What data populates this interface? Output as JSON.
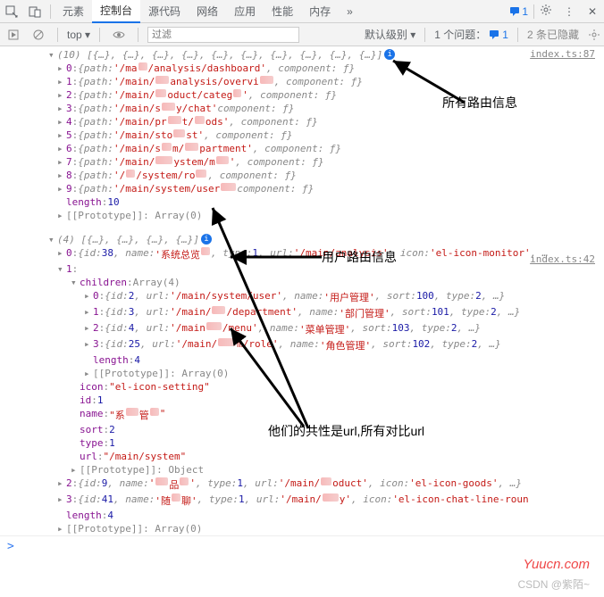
{
  "toolbar": {
    "tabs": [
      "元素",
      "控制台",
      "源代码",
      "网络",
      "应用",
      "性能",
      "内存"
    ],
    "active_tab_index": 1,
    "msg_count": "1",
    "gear_title": "设置",
    "more_glyph": "⋮",
    "close_glyph": "✕"
  },
  "subbar": {
    "context": "top ▾",
    "filter_placeholder": "过滤",
    "level": "默认级别 ▾",
    "issues_label": "1 个问题：",
    "issues_count": "1",
    "hidden_label": "2 条已隐藏"
  },
  "sources": {
    "first": "index.ts:87",
    "second": "index.ts:42"
  },
  "log1": {
    "header_count": "(10)",
    "header_preview": " [{…}, {…}, {…}, {…}, {…}, {…}, {…}, {…}, {…}, {…}]",
    "items": [
      {
        "idx": "0",
        "path_a": "'/ma",
        "path_b": "/analysis/dashboard'",
        "tail": ", component: ƒ}"
      },
      {
        "idx": "1",
        "path_a": "'/main/",
        "path_b": "analysis/overvi",
        "path_c": "",
        "tail": ", component: ƒ}"
      },
      {
        "idx": "2",
        "path_a": "'/main/",
        "path_b": "oduct/categ",
        "path_c": "'",
        "tail": ", component: ƒ}"
      },
      {
        "idx": "3",
        "path_a": "'/main/s",
        "path_b": "y/chat'",
        "tail": "  component: ƒ}"
      },
      {
        "idx": "4",
        "path_a": "'/main/pr",
        "path_b": "t/",
        "path_c": "ods'",
        "tail": ", component: ƒ}"
      },
      {
        "idx": "5",
        "path_a": "'/main/sto",
        "path_b": "st'",
        "tail": ", component: ƒ}"
      },
      {
        "idx": "6",
        "path_a": "'/main/s",
        "path_b": "m/",
        "path_c": "partment'",
        "tail": ", component: ƒ}"
      },
      {
        "idx": "7",
        "path_a": "'/main/",
        "path_b": "ystem/m",
        "path_c": "'",
        "tail": ", component: ƒ}"
      },
      {
        "idx": "8",
        "path_a": "'/",
        "path_b": "/system/ro",
        "path_c": "",
        "tail": ", component: ƒ}"
      },
      {
        "idx": "9",
        "path_a": "'/main/system/user",
        "path_b": "",
        "tail": "component: ƒ}"
      }
    ],
    "length_label": "length",
    "length_value": "10",
    "proto_label": "[[Prototype]]: Array(0)"
  },
  "log2": {
    "header_count": "(4)",
    "header_preview": " [{…}, {…}, {…}, {…}]",
    "item0": {
      "idx": "0",
      "id": "38",
      "name": "'系统总览",
      "type": "1",
      "url": "'/main/analysis'",
      "icon": "'el-icon-monitor'"
    },
    "item1_idx": "1",
    "children_label": "children",
    "children_type": "Array(4)",
    "children": [
      {
        "idx": "0",
        "id": "2",
        "url": "'/main/system/user'",
        "name": "'用户管理'",
        "sort": "100",
        "type": "2"
      },
      {
        "idx": "1",
        "id": "3",
        "url_a": "'/main/",
        "url_b": "/department'",
        "name": "'部门管理'",
        "sort": "101",
        "type": "2"
      },
      {
        "idx": "2",
        "id": "4",
        "url_a": "'/main",
        "url_b": "/menu'",
        "name": "'菜单管理'",
        "sort": "103",
        "type": "2"
      },
      {
        "idx": "3",
        "id": "25",
        "url_a": "'/main/",
        "url_b": "m/role'",
        "name": "'角色管理'",
        "sort": "102",
        "type": "2"
      }
    ],
    "children_length": "4",
    "children_proto": "[[Prototype]]: Array(0)",
    "icon_key": "icon",
    "icon_val": "\"el-icon-setting\"",
    "id_key": "id",
    "id_val": "1",
    "name_key": "name",
    "name_val": "\"系",
    "name_val2": "管",
    "name_val3": "\"",
    "sort_key": "sort",
    "sort_val": "2",
    "type_key": "type",
    "type_val": "1",
    "url_key": "url",
    "url_val": "\"/main/system\"",
    "proto_obj": "[[Prototype]]: Object",
    "item2": {
      "idx": "2",
      "id": "9",
      "type": "1",
      "icon": "'el-icon-goods'"
    },
    "item3": {
      "idx": "3",
      "id": "41",
      "type": "1",
      "icon": "'el-icon-chat-line-roun"
    },
    "length_val": "4",
    "proto_label": "[[Prototype]]: Array(0)"
  },
  "annotations": {
    "a1": "所有路由信息",
    "a2": "用户路由信息",
    "a3": "他们的共性是url,所有对比url"
  },
  "watermark": {
    "w1": "Yuucn.com",
    "w2": "CSDN @紫陌~"
  },
  "prompt": ">"
}
